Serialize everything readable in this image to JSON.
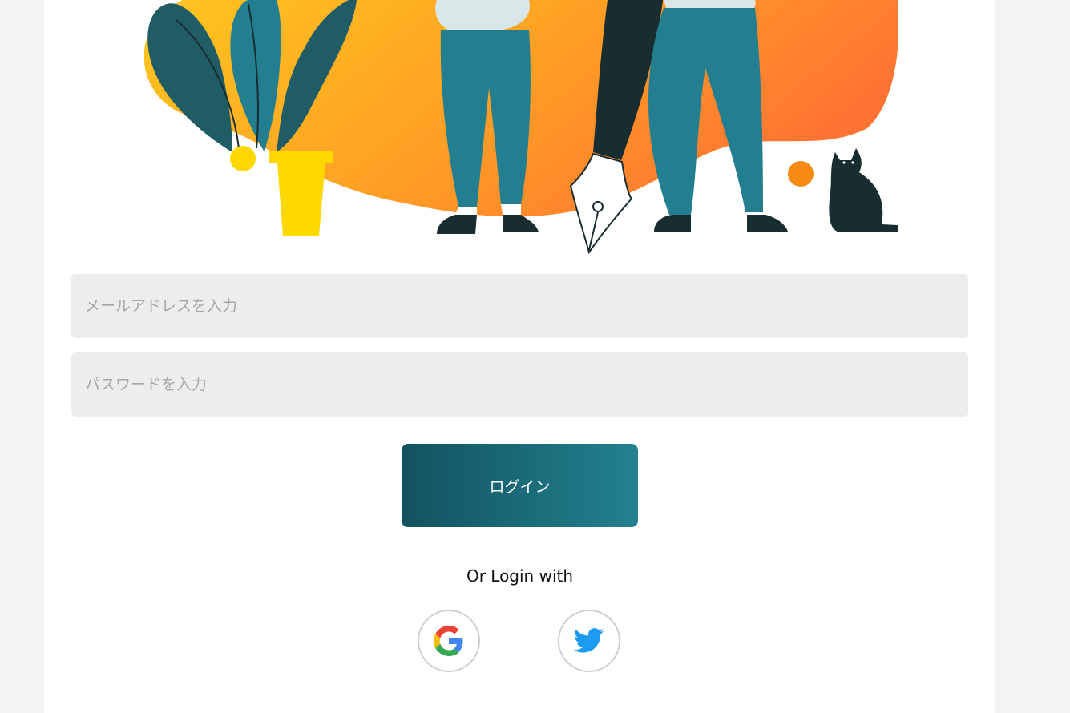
{
  "form": {
    "email_placeholder": "メールアドレスを入力",
    "password_placeholder": "パスワードを入力",
    "login_label": "ログイン"
  },
  "social": {
    "heading": "Or Login with",
    "providers": [
      {
        "name": "google",
        "icon": "google-icon"
      },
      {
        "name": "twitter",
        "icon": "twitter-icon",
        "color": "#1d9bf0"
      }
    ]
  },
  "colors": {
    "background": "#f3f3f2",
    "card": "#ffffff",
    "field": "#ededed",
    "button_start": "#135260",
    "button_end": "#23818f",
    "blob_start": "#ffc61f",
    "blob_end": "#ff7333",
    "teal": "#237f8f",
    "dark": "#172d30",
    "pot": "#ffd800"
  }
}
